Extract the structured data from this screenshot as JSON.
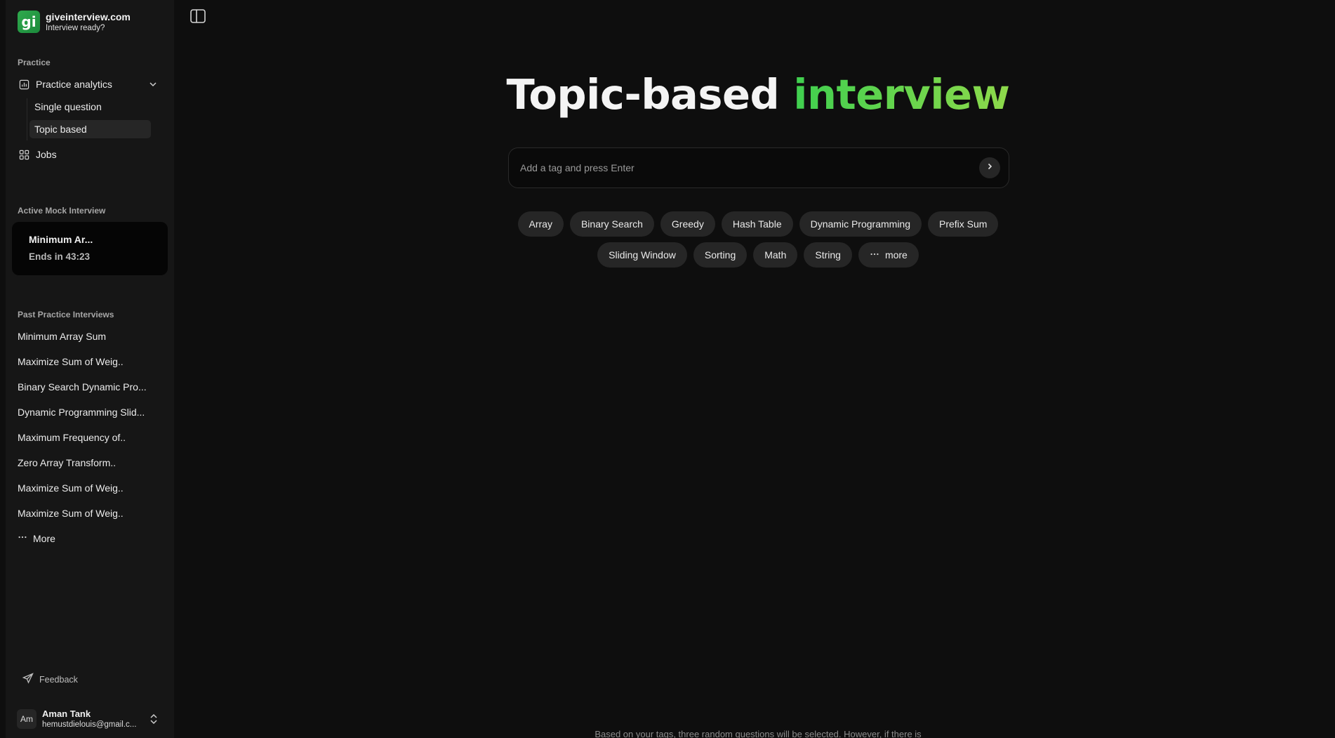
{
  "brand": {
    "logo_text": "gi",
    "name": "giveinterview.com",
    "tagline": "Interview ready?"
  },
  "sidebar": {
    "practice_label": "Practice",
    "practice_analytics": "Practice analytics",
    "sub_items": [
      "Single question",
      "Topic based"
    ],
    "jobs": "Jobs",
    "active_label": "Active Mock Interview",
    "active_mock": {
      "title": "Minimum Ar...",
      "ends": "Ends in 43:23"
    },
    "past_label": "Past Practice Interviews",
    "past_items": [
      "Minimum Array Sum",
      "Maximize Sum of Weig..",
      "Binary Search Dynamic Pro...",
      "Dynamic Programming Slid...",
      "Maximum Frequency of..",
      "Zero Array Transform..",
      "Maximize Sum of Weig..",
      "Maximize Sum of Weig.."
    ],
    "more": "More",
    "feedback": "Feedback",
    "user": {
      "initials": "Am",
      "name": "Aman Tank",
      "email": "hemustdielouis@gmail.c..."
    }
  },
  "main": {
    "headline_part1": "Topic-based",
    "headline_part2": "interview",
    "search_placeholder": "Add a tag and press Enter",
    "tags_row1": [
      "Array",
      "Binary Search",
      "Greedy",
      "Hash Table",
      "Dynamic Programming",
      "Prefix Sum"
    ],
    "tags_row2": [
      "Sliding Window",
      "Sorting",
      "Math",
      "String"
    ],
    "more_tags": "more",
    "footnote": "Based on your tags, three random questions will be selected. However, if there is"
  },
  "colors": {
    "accent_green": "#3fcf4f",
    "accent_green_end": "#8ed94b",
    "background": "#0e0e0e",
    "sidebar": "#161616"
  }
}
